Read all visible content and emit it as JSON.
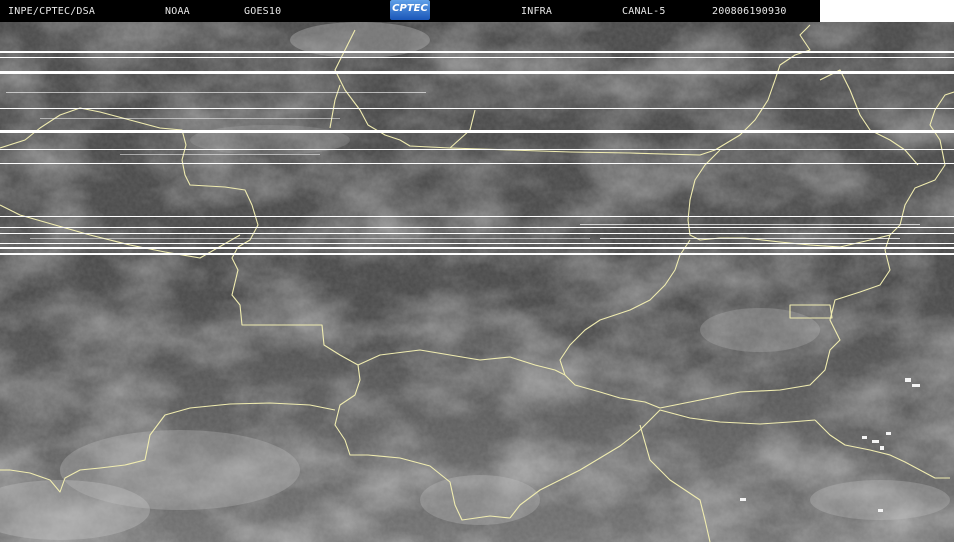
{
  "header": {
    "institution": "INPE/CPTEC/DSA",
    "agency": "NOAA",
    "satellite": "GOES10",
    "logo": "CPTEC",
    "product": "INFRA",
    "channel": "CANAL-5",
    "timestamp": "200806190930"
  },
  "colors": {
    "background": "#000000",
    "border_lines": "#f0ecb0",
    "scan_lines": "#ffffff"
  }
}
